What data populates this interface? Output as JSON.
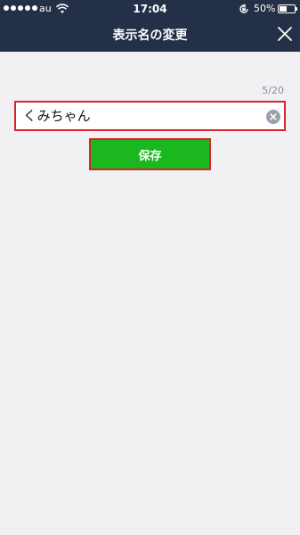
{
  "statusbar": {
    "carrier": "au",
    "time": "17:04",
    "battery_percent": "50%",
    "battery_level": 0.5,
    "signal_bars": 5,
    "icons": [
      "signal-icon",
      "wifi-icon",
      "rotation-lock-icon",
      "battery-icon"
    ]
  },
  "nav": {
    "title": "表示名の変更",
    "close_icon": "close-icon"
  },
  "form": {
    "counter": "5/20",
    "name_value": "くみちゃん",
    "clear_icon": "clear-icon",
    "save_label": "保存"
  },
  "colors": {
    "header_bg": "#243047",
    "page_bg": "#f1f1f4",
    "save_green": "#1bb71f",
    "highlight_red": "#d8232a"
  }
}
